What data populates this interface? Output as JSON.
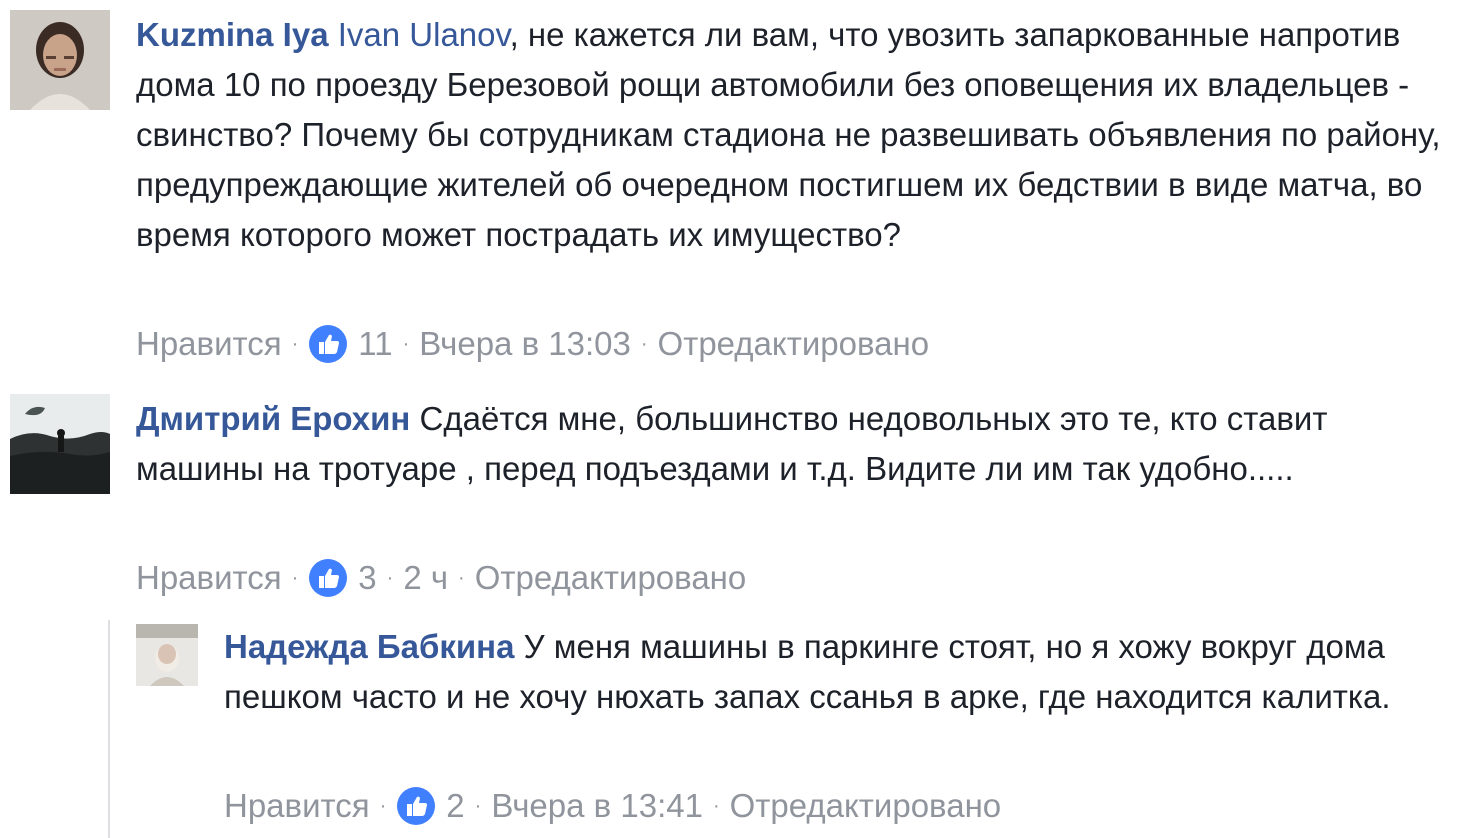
{
  "comments": [
    {
      "author": "Kuzmina Iya",
      "mention": "Ivan Ulanov",
      "text": ", не кажется ли вам, что увозить запаркованные напротив дома 10 по проезду Березовой рощи автомобили без оповещения их владельцев - свинство? Почему бы сотрудникам стадиона не развешивать объявления по району, предупреждающие жителей об очередном постигшем их бедствии в виде матча, во время которого может пострадать их имущество?",
      "like_label": "Нравится",
      "like_count": "11",
      "time": "Вчера в 13:03",
      "edited": "Отредактировано",
      "avatar_icon": "portrait-woman"
    },
    {
      "author": "Дмитрий Ерохин",
      "text": "Сдаётся мне, большинство недовольных это те, кто ставит машины на тротуаре , перед подъездами и т.д. Видите ли им так удобно.....",
      "like_label": "Нравится",
      "like_count": "3",
      "time": "2 ч",
      "edited": "Отредактировано",
      "avatar_icon": "landscape-person"
    },
    {
      "author": "Надежда Бабкина",
      "text": "У меня машины в паркинге стоят, но я хожу вокруг дома пешком часто и не хочу нюхать запах ссанья в арке, где находится калитка.",
      "like_label": "Нравится",
      "like_count": "2",
      "time": "Вчера в 13:41",
      "edited": "Отредактировано",
      "avatar_icon": "portrait-small"
    }
  ],
  "separator": "·",
  "colors": {
    "link": "#365899",
    "meta": "#90949c",
    "text": "#1d2129",
    "like_blue": "#4080ff"
  }
}
